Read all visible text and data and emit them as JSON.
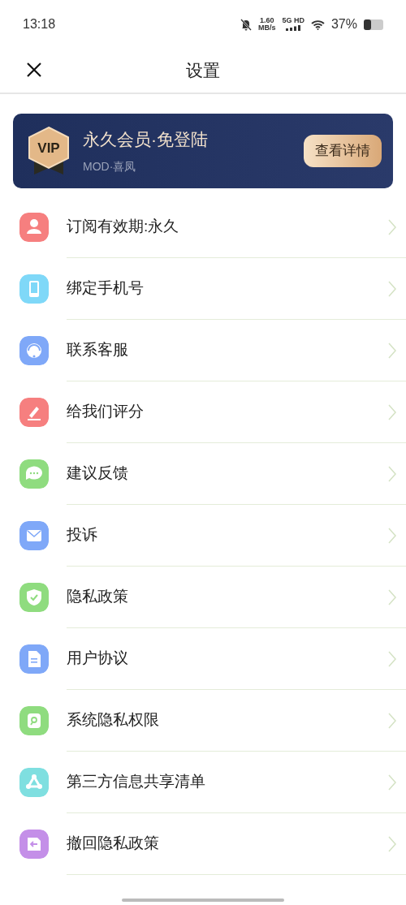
{
  "status_bar": {
    "time": "13:18",
    "speed_value": "1.60",
    "speed_unit": "MB/s",
    "network": "5G HD",
    "battery": "37%"
  },
  "header": {
    "title": "设置"
  },
  "vip_card": {
    "title": "永久会员·免登陆",
    "subtitle": "MOD·喜凤",
    "badge": "VIP",
    "button": "查看详情"
  },
  "items": [
    {
      "label": "订阅有效期:永久",
      "color": "#f67f7f"
    },
    {
      "label": "绑定手机号",
      "color": "#7fd8f8"
    },
    {
      "label": "联系客服",
      "color": "#7fa8f8"
    },
    {
      "label": "给我们评分",
      "color": "#f67f7f"
    },
    {
      "label": "建议反馈",
      "color": "#8fdc7f"
    },
    {
      "label": "投诉",
      "color": "#7fa8f8"
    },
    {
      "label": "隐私政策",
      "color": "#8fdc7f"
    },
    {
      "label": "用户协议",
      "color": "#7fa8f8"
    },
    {
      "label": "系统隐私权限",
      "color": "#8fdc7f"
    },
    {
      "label": "第三方信息共享清单",
      "color": "#7fdfe0"
    },
    {
      "label": "撤回隐私政策",
      "color": "#c48fe8"
    }
  ]
}
